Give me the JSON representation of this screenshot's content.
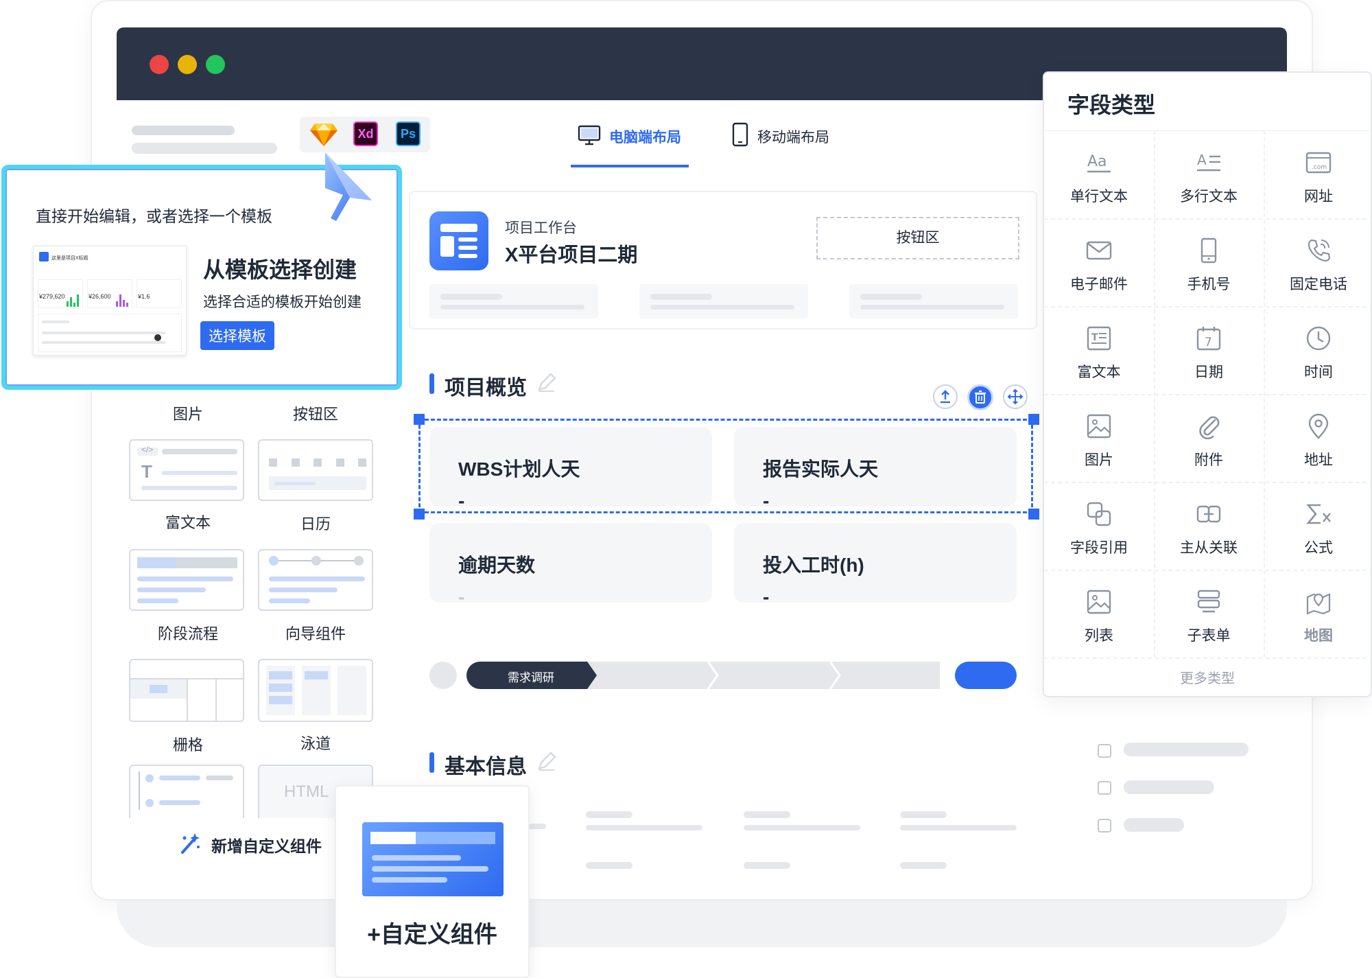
{
  "window": {
    "dots": [
      "#ef4444",
      "#eab308",
      "#22c55e"
    ]
  },
  "tools": [
    "Xd",
    "Ps"
  ],
  "tabs": [
    {
      "label": "电脑端布局",
      "active": true
    },
    {
      "label": "移动端布局",
      "active": false
    }
  ],
  "template_popup": {
    "intro": "直接开始编辑，或者选择一个模板",
    "title": "从模板选择创建",
    "subtitle": "选择合适的模板开始创建",
    "button": "选择模板",
    "preview": {
      "title": "这里是项目X标题",
      "kpis": [
        "¥279,620",
        "¥26,600",
        "¥1.6"
      ]
    }
  },
  "components": {
    "labels": [
      "图片",
      "按钮区",
      "富文本",
      "日历",
      "阶段流程",
      "向导组件",
      "栅格",
      "泳道"
    ],
    "html_label": "HTML",
    "add_custom": "新增自定义组件"
  },
  "workspace": {
    "subtitle": "项目工作台",
    "title": "X平台项目二期",
    "button_area": "按钮区"
  },
  "overview": {
    "title": "项目概览",
    "cards": [
      {
        "label": "WBS计划人天",
        "value": "-"
      },
      {
        "label": "报告实际人天",
        "value": "-"
      },
      {
        "label": "逾期天数",
        "value": "-"
      },
      {
        "label": "投入工时(h)",
        "value": "-"
      }
    ]
  },
  "stages": {
    "current": "需求调研"
  },
  "basic_info": {
    "title": "基本信息"
  },
  "field_types": {
    "title": "字段类型",
    "items": [
      "单行文本",
      "多行文本",
      "网址",
      "电子邮件",
      "手机号",
      "固定电话",
      "富文本",
      "日期",
      "时间",
      "图片",
      "附件",
      "地址",
      "字段引用",
      "主从关联",
      "公式",
      "列表",
      "子表单",
      "地图"
    ],
    "more": "更多类型"
  },
  "custom_card": {
    "label": "+自定义组件"
  },
  "colors": {
    "accent": "#2e6bf0",
    "dark": "#2b3547"
  }
}
